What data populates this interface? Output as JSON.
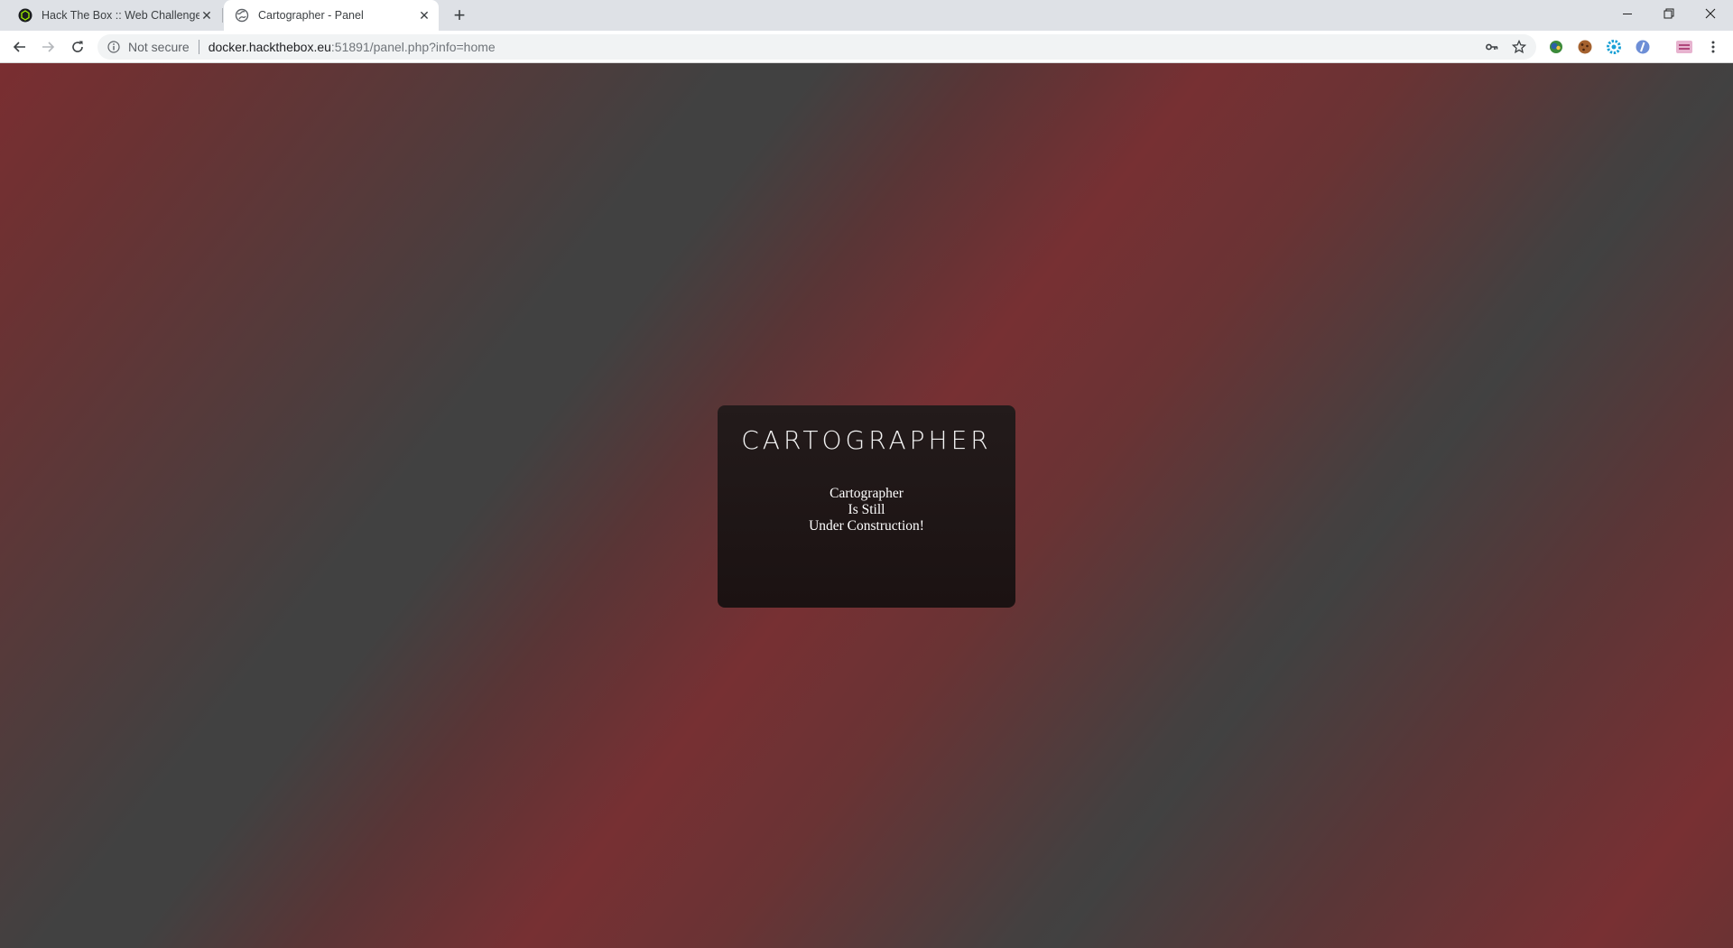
{
  "browser": {
    "tabs": [
      {
        "title": "Hack The Box :: Web Challenges",
        "active": false,
        "favicon": "htb-logo-icon"
      },
      {
        "title": "Cartographer - Panel",
        "active": true,
        "favicon": "globe-icon"
      }
    ],
    "address": {
      "security_label": "Not secure",
      "url_host": "docker.hackthebox.eu",
      "url_rest": ":51891/panel.php?info=home"
    }
  },
  "page": {
    "logo": "CARTOGRAPHER",
    "message_lines": [
      "Cartographer",
      "Is Still",
      "Under Construction!"
    ]
  },
  "colors": {
    "background_gray": "#414141",
    "background_red": "#773033",
    "card_background": "#1e1515",
    "tabbar": "#dee1e6"
  }
}
